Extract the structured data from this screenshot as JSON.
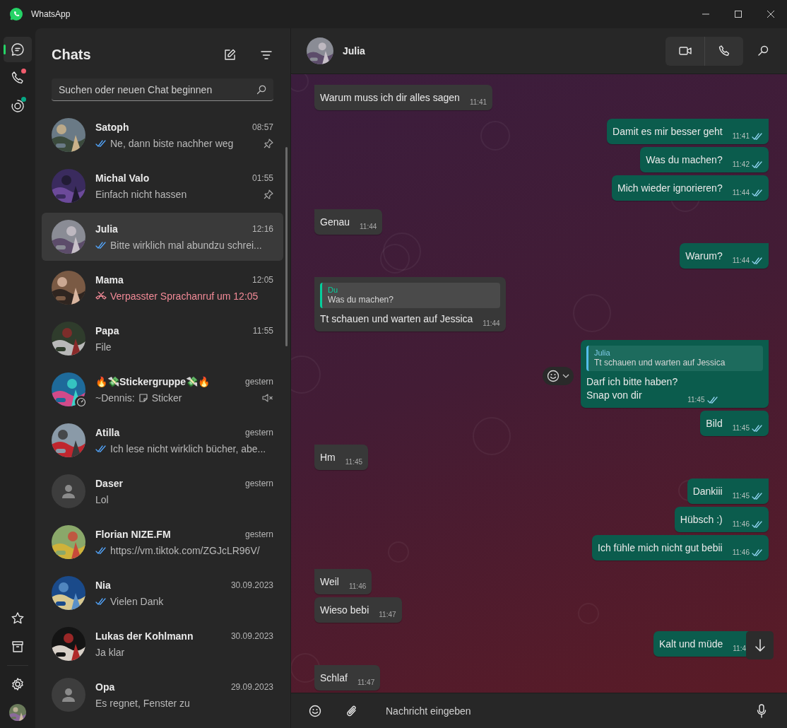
{
  "window": {
    "title": "WhatsApp"
  },
  "rail": {
    "items": [
      {
        "kind": "chats",
        "selected": true,
        "dot": false
      },
      {
        "kind": "calls",
        "selected": false,
        "dot": true
      },
      {
        "kind": "status",
        "selected": false,
        "dot": true
      }
    ]
  },
  "chat_list": {
    "title": "Chats",
    "search": {
      "placeholder": "Suchen oder neuen Chat beginnen"
    },
    "chats": [
      {
        "name": "Satoph",
        "time": "08:57",
        "preview": {
          "kind": "read",
          "text": "Ne, dann biste nachher weg"
        },
        "pinned": true,
        "muted": false,
        "selected": false
      },
      {
        "name": "Michal Valo",
        "time": "01:55",
        "preview": {
          "kind": "plain",
          "text": "Einfach nicht hassen"
        },
        "pinned": true,
        "muted": false,
        "selected": false
      },
      {
        "name": "Julia",
        "time": "12:16",
        "preview": {
          "kind": "read",
          "text": "Bitte wirklich mal abundzu schrei..."
        },
        "pinned": false,
        "muted": false,
        "selected": true
      },
      {
        "name": "Mama",
        "time": "12:05",
        "preview": {
          "kind": "missed_call",
          "text": "Verpasster Sprachanruf um 12:05"
        },
        "pinned": false,
        "muted": false,
        "selected": false
      },
      {
        "name": "Papa",
        "time": "11:55",
        "preview": {
          "kind": "plain",
          "text": "File"
        },
        "pinned": false,
        "muted": false,
        "selected": false
      },
      {
        "name": "🔥💸Stickergruppe💸🔥",
        "time": "gestern",
        "community": true,
        "preview": {
          "kind": "sticker",
          "sender": "~Dennis:",
          "text": "Sticker"
        },
        "pinned": false,
        "muted": true,
        "selected": false
      },
      {
        "name": "Atilla",
        "time": "gestern",
        "preview": {
          "kind": "read",
          "text": "Ich lese nicht wirklich bücher, abe..."
        },
        "pinned": false,
        "muted": false,
        "selected": false
      },
      {
        "name": "Daser",
        "time": "gestern",
        "avatar": {
          "kind": "default"
        },
        "preview": {
          "kind": "plain",
          "text": "Lol"
        },
        "pinned": false,
        "muted": false,
        "selected": false
      },
      {
        "name": "Florian NIZE.FM",
        "time": "gestern",
        "preview": {
          "kind": "read",
          "text": "https://vm.tiktok.com/ZGJcLR96V/"
        },
        "pinned": false,
        "muted": false,
        "selected": false
      },
      {
        "name": "Nia",
        "time": "30.09.2023",
        "preview": {
          "kind": "read",
          "text": "Vielen Dank"
        },
        "pinned": false,
        "muted": false,
        "selected": false
      },
      {
        "name": "Lukas der Kohlmann",
        "time": "30.09.2023",
        "preview": {
          "kind": "plain",
          "text": "Ja klar"
        },
        "pinned": false,
        "muted": false,
        "selected": false
      },
      {
        "name": "Opa",
        "time": "29.09.2023",
        "avatar": {
          "kind": "default"
        },
        "preview": {
          "kind": "plain",
          "text": "Es regnet, Fenster zu"
        },
        "pinned": false,
        "muted": false,
        "selected": false
      }
    ]
  },
  "conversation": {
    "contact": {
      "name": "Julia"
    },
    "messages": [
      {
        "kind": "incoming",
        "first": true,
        "text": "Warum muss ich dir alles sagen",
        "time": "11:41"
      },
      {
        "kind": "outgoing",
        "first": true,
        "text": "Damit es mir besser geht",
        "time": "11:41",
        "read": true
      },
      {
        "kind": "outgoing",
        "first": false,
        "text": "Was du machen?",
        "time": "11:42",
        "read": true
      },
      {
        "kind": "outgoing",
        "first": false,
        "text": "Mich wieder ignorieren?",
        "time": "11:44",
        "read": true
      },
      {
        "kind": "incoming",
        "first": true,
        "text": "Genau",
        "time": "11:44"
      },
      {
        "kind": "outgoing",
        "first": true,
        "text": "Warum?",
        "time": "11:44",
        "read": true
      },
      {
        "kind": "incoming",
        "first": true,
        "reply": {
          "name": "Du",
          "text": "Was du machen?"
        },
        "text": "Tt schauen und warten auf Jessica",
        "time": "11:44"
      },
      {
        "kind": "outgoing",
        "first": true,
        "reply": {
          "name": "Julia",
          "text": "Tt schauen und warten auf Jessica"
        },
        "text": "Darf ich bitte haben?\nSnap von dir",
        "time": "11:45",
        "read": true,
        "hovered": true
      },
      {
        "kind": "outgoing",
        "first": false,
        "text": "Bild",
        "time": "11:45",
        "read": true
      },
      {
        "kind": "incoming",
        "first": true,
        "text": "Hm",
        "time": "11:45"
      },
      {
        "kind": "outgoing",
        "first": true,
        "text": "Dankiii",
        "time": "11:45",
        "read": true
      },
      {
        "kind": "outgoing",
        "first": false,
        "text": "Hübsch :)",
        "time": "11:46",
        "read": true
      },
      {
        "kind": "outgoing",
        "first": false,
        "text": "Ich fühle mich nicht gut bebii",
        "time": "11:46",
        "read": true
      },
      {
        "kind": "incoming",
        "first": true,
        "text": "Weil",
        "time": "11:46"
      },
      {
        "kind": "incoming",
        "first": false,
        "text": "Wieso bebi",
        "time": "11:47"
      },
      {
        "kind": "outgoing",
        "first": true,
        "text": "Kalt und müde",
        "time": "11:4",
        "covered": true
      },
      {
        "kind": "incoming",
        "first": true,
        "text": "Schlaf",
        "time": "11:47"
      }
    ],
    "composer": {
      "placeholder": "Nachricht eingeben"
    }
  }
}
